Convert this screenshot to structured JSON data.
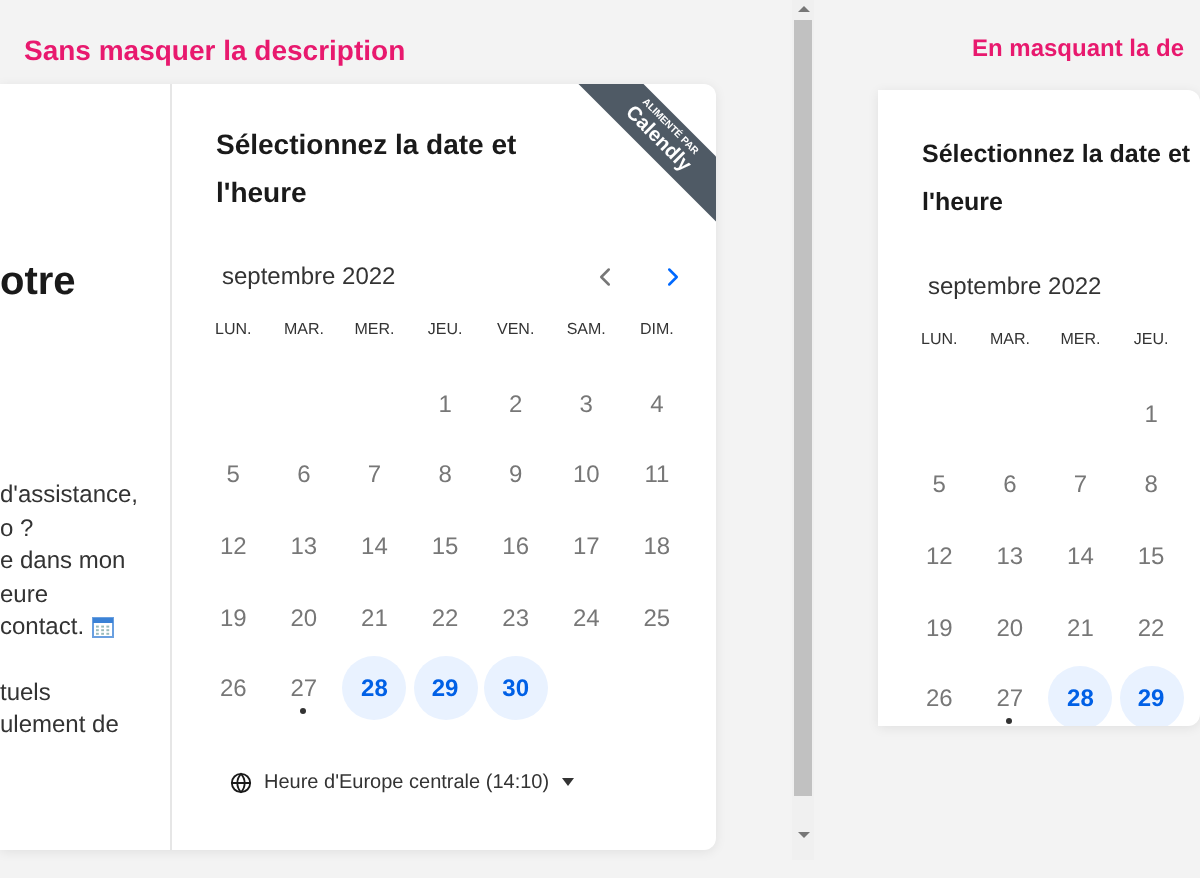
{
  "panels": [
    {
      "heading": "Sans masquer la description",
      "description": {
        "title": "otre",
        "lines": [
          {
            "text": "d'assistance,",
            "calendar_icon": false
          },
          {
            "text": "o ?",
            "calendar_icon": false
          },
          {
            "text": "e dans mon",
            "calendar_icon": false
          },
          {
            "text": "eure",
            "calendar_icon": false
          },
          {
            "text": "contact.",
            "calendar_icon": true
          },
          {
            "text": "tuels",
            "calendar_icon": false
          },
          {
            "text": "ulement de",
            "calendar_icon": false
          }
        ]
      },
      "badge": {
        "small": "ALIMENTÉ PAR",
        "brand": "Calendly"
      },
      "calendar": {
        "title": "Sélectionnez la date et l'heure",
        "month": "septembre 2022",
        "prev": {
          "disabled": true
        },
        "next": {
          "disabled": false
        },
        "weekdays": [
          "LUN.",
          "MAR.",
          "MER.",
          "JEU.",
          "VEN.",
          "SAM.",
          "DIM."
        ],
        "weeks": [
          [
            {
              "label": "1",
              "available": false,
              "today": false
            },
            {
              "label": "2",
              "available": false,
              "today": false
            },
            {
              "label": "3",
              "available": false,
              "today": false
            },
            {
              "label": "4",
              "available": false,
              "today": false
            }
          ],
          [
            {
              "label": "5",
              "available": false,
              "today": false
            },
            {
              "label": "6",
              "available": false,
              "today": false
            },
            {
              "label": "7",
              "available": false,
              "today": false
            },
            {
              "label": "8",
              "available": false,
              "today": false
            },
            {
              "label": "9",
              "available": false,
              "today": false
            },
            {
              "label": "10",
              "available": false,
              "today": false
            },
            {
              "label": "11",
              "available": false,
              "today": false
            }
          ],
          [
            {
              "label": "12",
              "available": false,
              "today": false
            },
            {
              "label": "13",
              "available": false,
              "today": false
            },
            {
              "label": "14",
              "available": false,
              "today": false
            },
            {
              "label": "15",
              "available": false,
              "today": false
            },
            {
              "label": "16",
              "available": false,
              "today": false
            },
            {
              "label": "17",
              "available": false,
              "today": false
            },
            {
              "label": "18",
              "available": false,
              "today": false
            }
          ],
          [
            {
              "label": "19",
              "available": false,
              "today": false
            },
            {
              "label": "20",
              "available": false,
              "today": false
            },
            {
              "label": "21",
              "available": false,
              "today": false
            },
            {
              "label": "22",
              "available": false,
              "today": false
            },
            {
              "label": "23",
              "available": false,
              "today": false
            },
            {
              "label": "24",
              "available": false,
              "today": false
            },
            {
              "label": "25",
              "available": false,
              "today": false
            }
          ],
          [
            {
              "label": "26",
              "available": false,
              "today": false
            },
            {
              "label": "27",
              "available": false,
              "today": true
            },
            {
              "label": "28",
              "available": true,
              "today": false
            },
            {
              "label": "29",
              "available": true,
              "today": false
            },
            {
              "label": "30",
              "available": true,
              "today": false
            }
          ]
        ],
        "timezone": "Heure d'Europe centrale (14:10)"
      }
    },
    {
      "heading": "En masquant la de",
      "calendar": {
        "title": "Sélectionnez la date et l'heure",
        "month": "septembre 2022",
        "weekdays": [
          "LUN.",
          "MAR.",
          "MER.",
          "JEU."
        ],
        "weeks": [
          [
            {
              "label": "1",
              "available": false,
              "today": false
            }
          ],
          [
            {
              "label": "5",
              "available": false,
              "today": false
            },
            {
              "label": "6",
              "available": false,
              "today": false
            },
            {
              "label": "7",
              "available": false,
              "today": false
            },
            {
              "label": "8",
              "available": false,
              "today": false
            }
          ],
          [
            {
              "label": "12",
              "available": false,
              "today": false
            },
            {
              "label": "13",
              "available": false,
              "today": false
            },
            {
              "label": "14",
              "available": false,
              "today": false
            },
            {
              "label": "15",
              "available": false,
              "today": false
            }
          ],
          [
            {
              "label": "19",
              "available": false,
              "today": false
            },
            {
              "label": "20",
              "available": false,
              "today": false
            },
            {
              "label": "21",
              "available": false,
              "today": false
            },
            {
              "label": "22",
              "available": false,
              "today": false
            }
          ],
          [
            {
              "label": "26",
              "available": false,
              "today": false
            },
            {
              "label": "27",
              "available": false,
              "today": true
            },
            {
              "label": "28",
              "available": true,
              "today": false
            },
            {
              "label": "29",
              "available": true,
              "today": false
            }
          ]
        ]
      }
    }
  ]
}
